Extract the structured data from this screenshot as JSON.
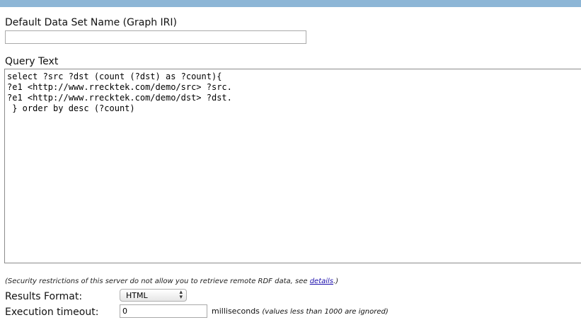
{
  "default_dataset": {
    "label": "Default Data Set Name (Graph IRI)",
    "value": ""
  },
  "query": {
    "label": "Query Text",
    "text": "select ?src ?dst (count (?dst) as ?count){\n?e1 <http://www.rrecktek.com/demo/src> ?src.\n?e1 <http://www.rrecktek.com/demo/dst> ?dst.\n } order by desc (?count)"
  },
  "security_note": {
    "text": "(Security restrictions of this server do not allow you to retrieve remote RDF data, see ",
    "link": "details",
    "end": ".)"
  },
  "results_format": {
    "label": "Results Format:",
    "selected": "HTML"
  },
  "execution_timeout": {
    "label": "Execution timeout:",
    "value": "0",
    "unit": "milliseconds",
    "note": "(values less than 1000 are ignored)"
  },
  "colors": {
    "header_bar": "#8db6d6",
    "link": "#1a0dab"
  }
}
